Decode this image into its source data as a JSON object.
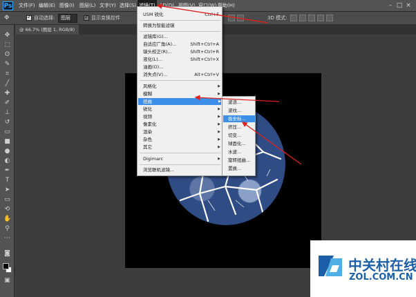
{
  "app": {
    "logo": "Ps"
  },
  "menubar": {
    "items": [
      {
        "label": "文件(F)"
      },
      {
        "label": "编辑(E)"
      },
      {
        "label": "图像(I)"
      },
      {
        "label": "图层(L)"
      },
      {
        "label": "文字(Y)"
      },
      {
        "label": "选择(S)"
      },
      {
        "label": "滤镜(T)"
      },
      {
        "label": "3D(D)"
      },
      {
        "label": "视图(V)"
      },
      {
        "label": "窗口(W)"
      },
      {
        "label": "帮助(H)"
      }
    ],
    "active": "滤镜(T)",
    "window_controls": [
      "–",
      "□",
      "×"
    ]
  },
  "options_bar": {
    "auto_select_label": "自动选择:",
    "auto_select_value": "图层",
    "show_transform_label": "显示变换控件",
    "mode_3d_label": "3D 模式:"
  },
  "document_tab": {
    "title": "@ 66.7% (图层 1, RGB/8)"
  },
  "filter_menu": {
    "items": [
      {
        "label": "USM 锐化",
        "shortcut": "Ctrl+F"
      },
      {
        "label": "转换为智能滤镜"
      },
      {
        "label": "滤镜库(G)..."
      },
      {
        "label": "自适应广角(A)...",
        "shortcut": "Shift+Ctrl+A"
      },
      {
        "label": "镜头校正(R)...",
        "shortcut": "Shift+Ctrl+R"
      },
      {
        "label": "液化(L)...",
        "shortcut": "Shift+Ctrl+X"
      },
      {
        "label": "油画(O)..."
      },
      {
        "label": "消失点(V)...",
        "shortcut": "Alt+Ctrl+V"
      },
      {
        "label": "风格化"
      },
      {
        "label": "模糊"
      },
      {
        "label": "扭曲",
        "highlighted": true
      },
      {
        "label": "锐化"
      },
      {
        "label": "视频"
      },
      {
        "label": "像素化"
      },
      {
        "label": "渲染"
      },
      {
        "label": "杂色"
      },
      {
        "label": "其它"
      },
      {
        "label": "Digimarc"
      },
      {
        "label": "浏览联机滤镜..."
      }
    ]
  },
  "distort_submenu": {
    "items": [
      {
        "label": "波浪..."
      },
      {
        "label": "波纹..."
      },
      {
        "label": "极坐标...",
        "highlighted": true
      },
      {
        "label": "挤压..."
      },
      {
        "label": "切变..."
      },
      {
        "label": "球面化..."
      },
      {
        "label": "水波..."
      },
      {
        "label": "旋转扭曲..."
      },
      {
        "label": "置换..."
      }
    ]
  },
  "watermark": {
    "name_cn": "中关村在线",
    "domain": "ZOL.COM.CN"
  },
  "colors": {
    "menu_highlight": "#3c8ee8",
    "annotation_red": "#e0201c",
    "watermark_blue": "#1a5fa8"
  }
}
